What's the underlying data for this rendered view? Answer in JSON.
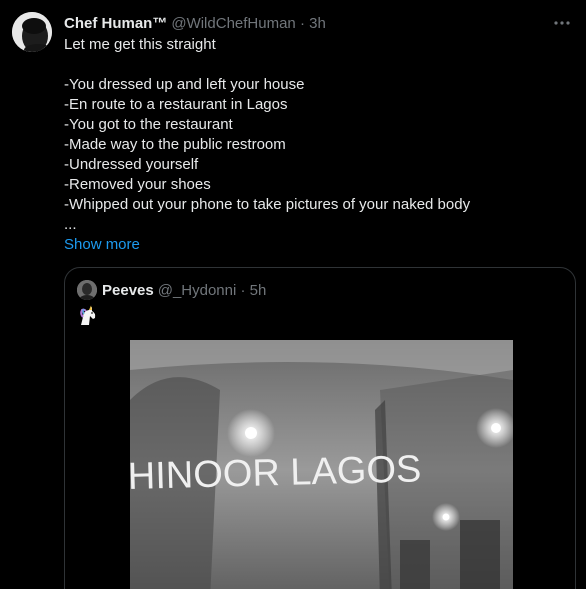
{
  "tweet": {
    "author_name": "Chef Human™",
    "author_handle": "@WildChefHuman · 3h",
    "lines": [
      "Let me get this straight",
      "",
      "-You dressed up and left your house",
      "-En route to a restaurant in Lagos",
      "-You got to the restaurant",
      "-Made way to the public restroom",
      "-Undressed yourself",
      "-Removed your shoes",
      "-Whipped out your phone to take pictures of your naked body",
      "..."
    ],
    "show_more_label": "Show more"
  },
  "quoted_tweet": {
    "author_name": "Peeves",
    "author_handle": "@_Hydonni · 5h",
    "emoji_icon": "unicorn-icon",
    "image_sign_text": "HINOOR LAGOS"
  },
  "colors": {
    "background": "#000000",
    "text": "#e7e9ea",
    "secondary": "#71767b",
    "link": "#1d9bf0",
    "border": "#2f3336"
  }
}
